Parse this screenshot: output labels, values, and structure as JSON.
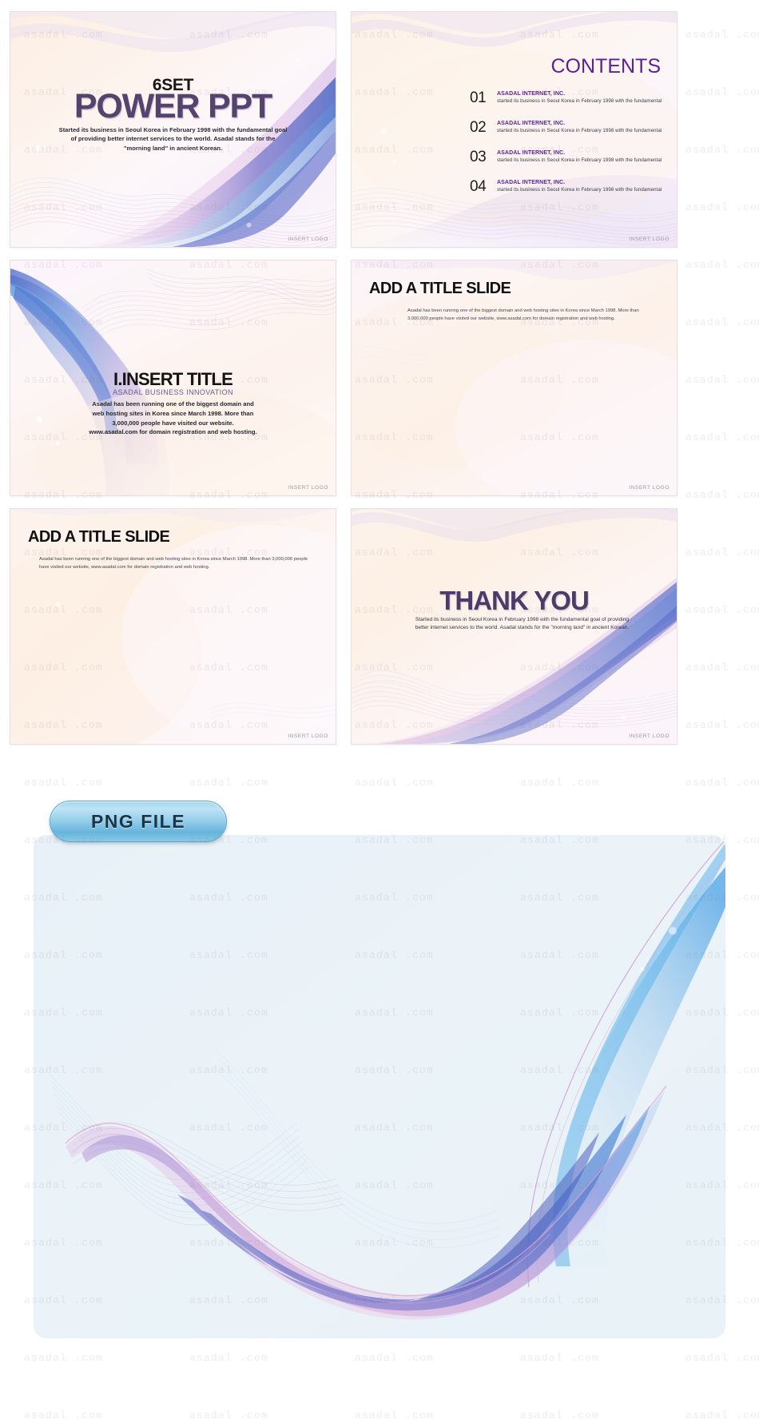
{
  "slides": [
    {
      "name": "title-slide",
      "eyebrow": "6SET",
      "title": "POWER PPT",
      "description": "Started its business in Seoul Korea in February 1998 with the fundamental goal of providing better internet services to the world. Asadal stands for the \"morning land\" in ancient Korean.",
      "footer": "INSERT LOGO"
    },
    {
      "name": "contents-slide",
      "heading": "CONTENTS",
      "footer": "INSERT LOGO",
      "items": [
        {
          "number": "01",
          "title": "ASADAL INTERNET, INC.",
          "subtitle": "started its business in Seoul Korea in February 1998 with the fundamental"
        },
        {
          "number": "02",
          "title": "ASADAL INTERNET, INC.",
          "subtitle": "started its business in Seoul Korea in February 1998 with the fundamental"
        },
        {
          "number": "03",
          "title": "ASADAL INTERNET, INC.",
          "subtitle": "started its business in Seoul Korea in February 1998 with the fundamental"
        },
        {
          "number": "04",
          "title": "ASADAL INTERNET, INC.",
          "subtitle": "started its business in Seoul Korea in February 1998 with the fundamental"
        }
      ]
    },
    {
      "name": "insert-title-slide",
      "title": "I.INSERT TITLE",
      "subtitle": "ASADAL BUSINESS INNOVATION",
      "body": "Asadal has been running one of the biggest domain and web hosting sites in Korea since March 1998. More than 3,000,000 people have visited our website. www.asadal.com for domain registration and web hosting.",
      "footer": "INSERT LOGO"
    },
    {
      "name": "add-title-slide-a",
      "title": "ADD A TITLE SLIDE",
      "body": "Asadal has been running one of the biggest domain and web hosting sites in Korea since March 1998. More than 3,000,000 people have visited our website, www.asadal.com for domain registration and web hosting.",
      "footer": "INSERT LOGO"
    },
    {
      "name": "add-title-slide-b",
      "title": "ADD A TITLE SLIDE",
      "body": "Asadal has been running one of the biggest domain and web hosting sites in Korea since March 1998. More than 3,000,000 people have visited our website, www.asadal.com for domain registration and web hosting.",
      "footer": "INSERT LOGO"
    },
    {
      "name": "thank-you-slide",
      "title": "THANK YOU",
      "description": "Started its business in Seoul Korea in February 1998 with the fundamental goal of providing better internet services to the world. Asadal stands for the \"morning land\" in ancient Korean.",
      "footer": "INSERT LOGO"
    }
  ],
  "png_section": {
    "button_label": "PNG FILE"
  },
  "watermark": {
    "text": "asadal .com"
  },
  "colors": {
    "title_purple": "#53436d",
    "heading_purple": "#5b1f96",
    "accent_blue": "#4a6fd0",
    "accent_pink": "#d08fc8",
    "panel_bg": "#e9f2f7",
    "button_blue": "#8fcbe8"
  }
}
